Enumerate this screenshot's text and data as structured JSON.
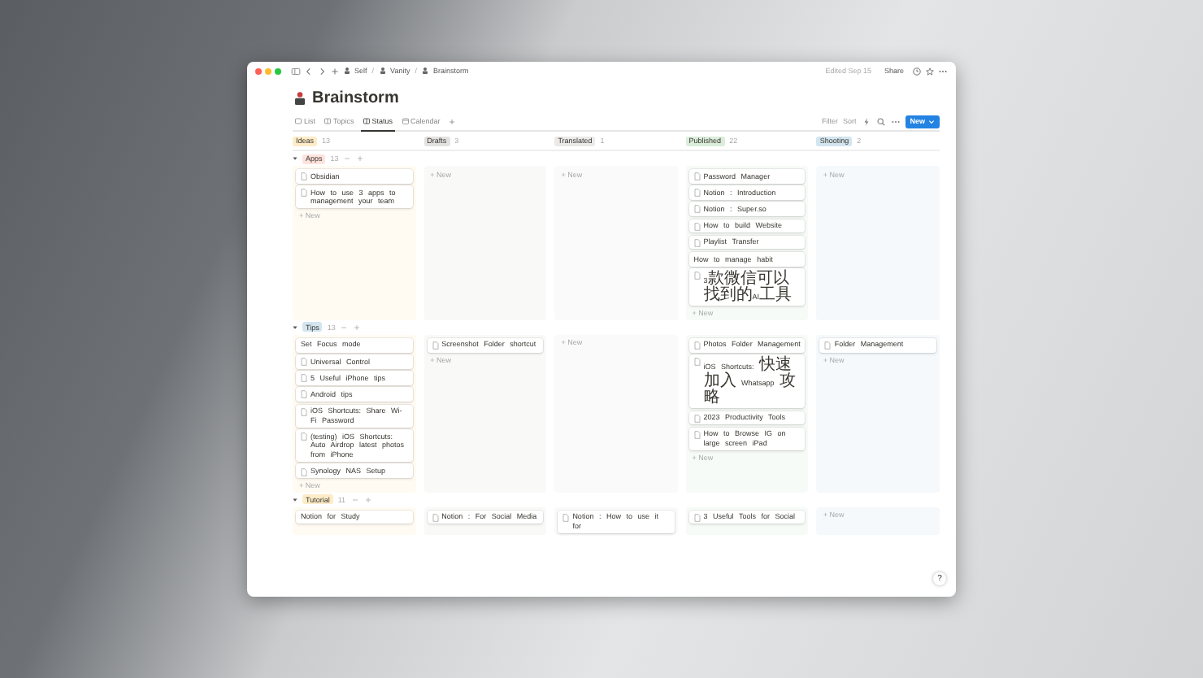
{
  "breadcrumbs": [
    {
      "label": "Self",
      "sep": "/"
    },
    {
      "label": "Vanity",
      "sep": "/"
    },
    {
      "label": "Brainstorm"
    }
  ],
  "edited": "Edited Sep 15",
  "share": "Share",
  "page_title": "Brainstorm",
  "views": [
    {
      "label": "List",
      "selected": false,
      "kind": "list"
    },
    {
      "label": "Topics",
      "selected": false,
      "kind": "board"
    },
    {
      "label": "Status",
      "selected": true,
      "kind": "board"
    },
    {
      "label": "Calendar",
      "selected": false,
      "kind": "calendar"
    }
  ],
  "toolbar": {
    "filter": "Filter",
    "sort": "Sort",
    "new_button": "New"
  },
  "columns": [
    {
      "label": "Ideas",
      "count": "13",
      "color": "#fdecc8"
    },
    {
      "label": "Drafts",
      "count": "3",
      "color": "#e3e2e0"
    },
    {
      "label": "Translated",
      "count": "1",
      "color": "#ebeae8"
    },
    {
      "label": "Published",
      "count": "22",
      "color": "#dbeddb"
    },
    {
      "label": "Shooting",
      "count": "2",
      "color": "#d3e5ef"
    }
  ],
  "groups": [
    {
      "label": "Apps",
      "count": "13",
      "color": "#ffe2dd",
      "expanded": true,
      "columns": [
        {
          "cards": [
            {
              "title": "Obsidian",
              "kind": "page"
            },
            {
              "title": "How to use 3 apps to management your team",
              "kind": "page"
            }
          ],
          "new": "+ New"
        },
        {
          "new": "+ New"
        },
        {
          "new": "+ New"
        },
        {
          "cards": [
            {
              "title": "Password Manager",
              "kind": "page"
            },
            {
              "title": "Notion : Introduction",
              "kind": "page"
            },
            {
              "title": "Notion : Super.so",
              "kind": "page"
            },
            {
              "title": "How to build Website",
              "kind": "page"
            },
            {
              "title": "Playlist Transfer",
              "kind": "page"
            },
            {
              "title": "How to manage habit",
              "kind": "plain"
            },
            {
              "title": "3款微信可以找到的AI工具",
              "kind": "page"
            }
          ],
          "new": "+ New"
        },
        {
          "new": "+ New"
        }
      ]
    },
    {
      "label": "Tips",
      "count": "13",
      "color": "#d3e5ef",
      "expanded": true,
      "columns": [
        {
          "cards": [
            {
              "title": "Set Focus mode",
              "kind": "plain"
            },
            {
              "title": "Universal Control",
              "kind": "page"
            },
            {
              "title": "5 Useful iPhone tips",
              "kind": "page"
            },
            {
              "title": "Android tips",
              "kind": "page"
            },
            {
              "title": "iOS Shortcuts: Share Wi-Fi Password",
              "kind": "page"
            },
            {
              "title": "(testing) iOS Shortcuts: Auto Airdrop latest photos from iPhone",
              "kind": "page"
            },
            {
              "title": "Synology NAS Setup",
              "kind": "page"
            }
          ],
          "new": "+ New"
        },
        {
          "cards": [
            {
              "title": "Screenshot Folder shortcut",
              "kind": "page"
            }
          ],
          "new": "+ New"
        },
        {
          "new": "+ New"
        },
        {
          "cards": [
            {
              "title": "Photos Folder Management",
              "kind": "page"
            },
            {
              "title": "iOS Shortcuts: 快速加入 Whatsapp 攻略",
              "kind": "page"
            },
            {
              "title": "2023 Productivity Tools",
              "kind": "page"
            },
            {
              "title": "How to Browse IG on large screen iPad",
              "kind": "page"
            }
          ],
          "new": "+ New"
        },
        {
          "cards": [
            {
              "title": "Folder Management",
              "kind": "page"
            }
          ],
          "new": "+ New"
        }
      ]
    },
    {
      "label": "Tutorial",
      "count": "11",
      "color": "#fdecc8",
      "expanded": true,
      "columns": [
        {
          "cards": [
            {
              "title": "Notion for Study",
              "kind": "plain"
            }
          ]
        },
        {
          "cards": [
            {
              "title": "Notion : For Social Media",
              "kind": "page"
            }
          ]
        },
        {
          "cards": [
            {
              "title": "Notion : How to use it for",
              "kind": "page"
            }
          ]
        },
        {
          "cards": [
            {
              "title": "3 Useful Tools for Social",
              "kind": "page"
            }
          ]
        },
        {
          "new": "+ New"
        }
      ]
    }
  ],
  "help": "?"
}
